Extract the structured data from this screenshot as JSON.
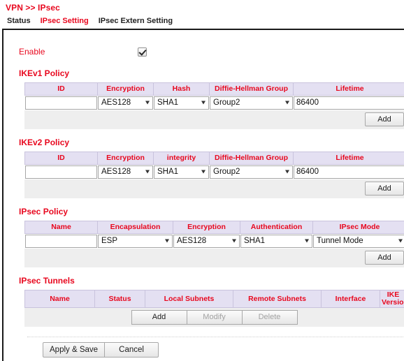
{
  "breadcrumb": "VPN >> IPsec",
  "tabs": [
    {
      "label": "Status",
      "active": false
    },
    {
      "label": "IPsec Setting",
      "active": true
    },
    {
      "label": "IPsec Extern Setting",
      "active": false
    }
  ],
  "enable": {
    "label": "Enable",
    "checked": true
  },
  "sections": {
    "ikev1": {
      "title": "IKEv1 Policy",
      "headers": [
        "ID",
        "Encryption",
        "Hash",
        "Diffie-Hellman Group",
        "Lifetime"
      ],
      "row": {
        "id": "",
        "id_placeholder": "",
        "encryption": "AES128",
        "hash": "SHA1",
        "dh_group": "Group2",
        "lifetime": "86400"
      },
      "add_label": "Add"
    },
    "ikev2": {
      "title": "IKEv2 Policy",
      "headers": [
        "ID",
        "Encryption",
        "integrity",
        "Diffie-Hellman Group",
        "Lifetime"
      ],
      "row": {
        "id": "",
        "id_placeholder": "",
        "encryption": "AES128",
        "integrity": "SHA1",
        "dh_group": "Group2",
        "lifetime": "86400"
      },
      "add_label": "Add"
    },
    "ipsec_policy": {
      "title": "IPsec Policy",
      "headers": [
        "Name",
        "Encapsulation",
        "Encryption",
        "Authentication",
        "IPsec Mode"
      ],
      "row": {
        "name": "",
        "name_placeholder": "",
        "encapsulation": "ESP",
        "encryption": "AES128",
        "authentication": "SHA1",
        "ipsec_mode": "Tunnel Mode"
      },
      "add_label": "Add"
    },
    "ipsec_tunnels": {
      "title": "IPsec Tunnels",
      "headers": [
        "Name",
        "Status",
        "Local Subnets",
        "Remote Subnets",
        "Interface",
        "IKE Version"
      ],
      "rows": [],
      "buttons": [
        {
          "label": "Add",
          "disabled": false
        },
        {
          "label": "Modify",
          "disabled": true
        },
        {
          "label": "Delete",
          "disabled": true
        }
      ]
    }
  },
  "footer": {
    "apply_label": "Apply & Save",
    "cancel_label": "Cancel"
  },
  "colors": {
    "accent_red": "#e8071e",
    "header_bg": "#e4e0f2",
    "action_bg": "#eeeeee"
  }
}
